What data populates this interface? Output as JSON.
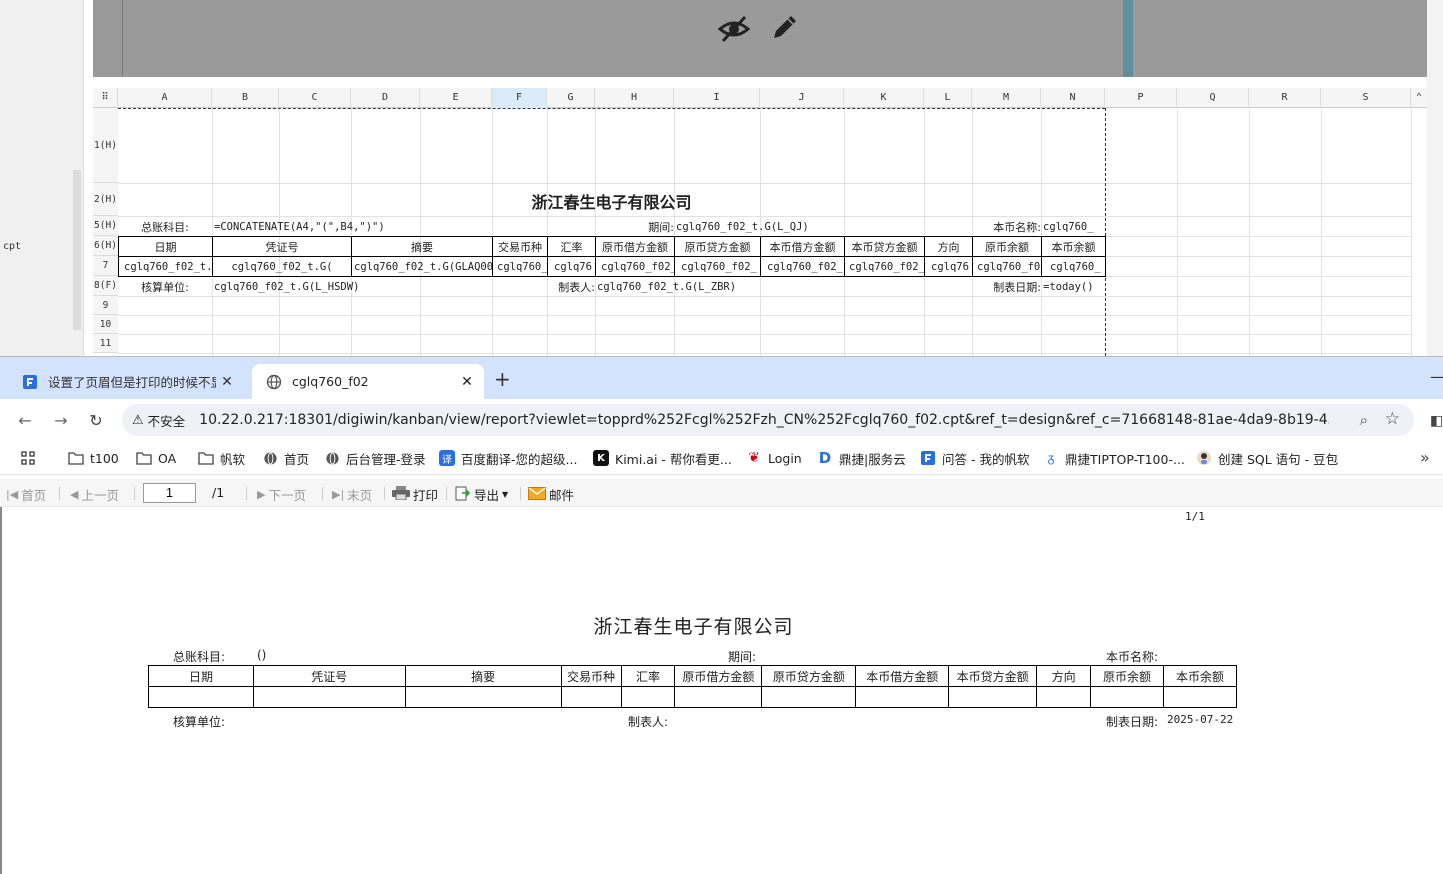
{
  "designer": {
    "left_label": "cpt",
    "columns": [
      "A",
      "B",
      "C",
      "D",
      "E",
      "F",
      "G",
      "H",
      "I",
      "J",
      "K",
      "L",
      "M",
      "N",
      "P",
      "Q",
      "R",
      "S"
    ],
    "rows": [
      "1(H)",
      "2(H)",
      "5(H)",
      "6(H)",
      "7",
      "8(F)",
      "9",
      "10",
      "11"
    ],
    "company_title": "浙江春生电子有限公司",
    "row5": {
      "label_account": "总账科目:",
      "formula_account": "=CONCATENATE(A4,\"(\",B4,\")\")",
      "label_period": "期间:",
      "formula_period": "cglq760_f02_t.G(L_QJ)",
      "label_currency": "本币名称:",
      "formula_currency": "cglq760_"
    },
    "headers": [
      "日期",
      "凭证号",
      "摘要",
      "交易币种",
      "汇率",
      "原币借方金额",
      "原币贷方金额",
      "本币借方金额",
      "本币贷方金额",
      "方向",
      "原币余额",
      "本币余额"
    ],
    "row7": [
      "cglq760_f02_t.",
      "cglq760_f02_t.G(",
      "cglq760_f02_t.G(GLAQ001",
      "cglq760_",
      "cglq76",
      "cglq760_f02_",
      "cglq760_f02_",
      "cglq760_f02_",
      "cglq760_f02_",
      "cglq76",
      "cglq760_f0",
      "cglq760_"
    ],
    "row8": {
      "label_unit": "核算单位:",
      "formula_unit": "cglq760_f02_t.G(L_HSDW)",
      "label_maker": "制表人:",
      "formula_maker": "cglq760_f02_t.G(L_ZBR)",
      "label_date": "制表日期:",
      "formula_date": "=today()"
    }
  },
  "browser": {
    "tabs": [
      {
        "title": "设置了页眉但是打印的时候不显",
        "active": false
      },
      {
        "title": "cglq760_f02",
        "active": true
      }
    ],
    "security_label": "不安全",
    "url": "10.22.0.217:18301/digiwin/kanban/view/report?viewlet=topprd%252Fcgl%252Fzh_CN%252Fcglq760_f02.cpt&ref_t=design&ref_c=71668148-81ae-4da9-8b19-45a4034...",
    "bookmarks": [
      "t100",
      "OA",
      "帆软",
      "首页",
      "后台管理-登录",
      "百度翻译-您的超级...",
      "Kimi.ai - 帮你看更...",
      "Login",
      "鼎捷|服务云",
      "问答 - 我的帆软",
      "鼎捷TIPTOP-T100-...",
      "创建 SQL 语句 - 豆包"
    ]
  },
  "report_toolbar": {
    "first": "首页",
    "prev": "上一页",
    "page_value": "1",
    "page_total": "/1",
    "next": "下一页",
    "last": "末页",
    "print": "打印",
    "export": "导出",
    "mail": "邮件"
  },
  "report": {
    "page_indicator": "1/1",
    "title": "浙江春生电子有限公司",
    "account_label": "总账科目:",
    "account_value": "()",
    "period_label": "期间:",
    "currency_label": "本币名称:",
    "headers": [
      "日期",
      "凭证号",
      "摘要",
      "交易币种",
      "汇率",
      "原币借方金额",
      "原币贷方金额",
      "本币借方金额",
      "本币贷方金额",
      "方向",
      "原币余额",
      "本币余额"
    ],
    "unit_label": "核算单位:",
    "maker_label": "制表人:",
    "date_label": "制表日期:",
    "date_value": "2025-07-22"
  }
}
